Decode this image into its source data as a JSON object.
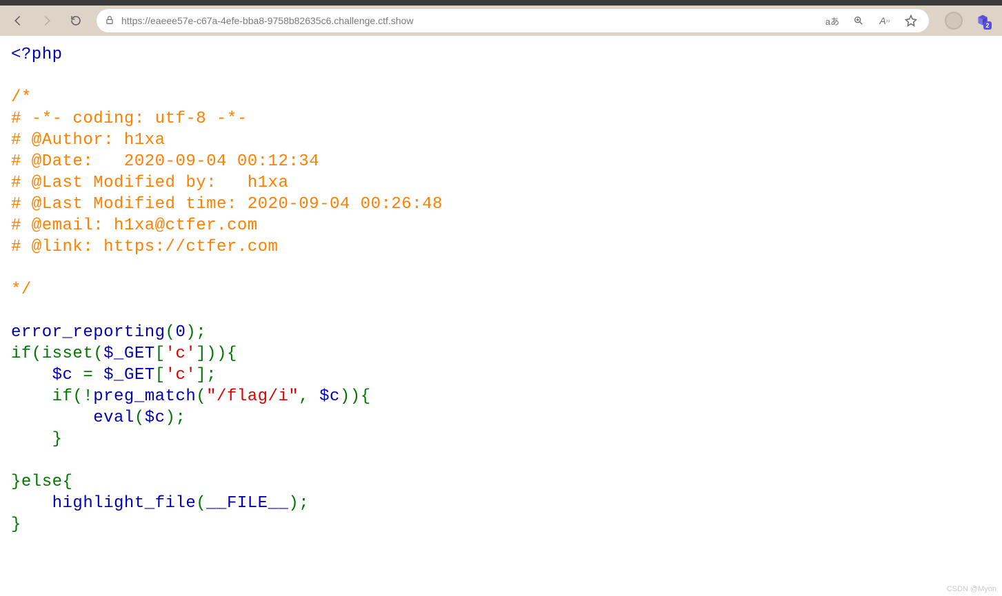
{
  "toolbar": {
    "url": "https://eaeee57e-c67a-4efe-bba8-9758b82635c6.challenge.ctf.show",
    "translate_label": "aあ",
    "ext_badge": "2"
  },
  "code": {
    "php_open": "<?php",
    "comment_open": "/*",
    "c1": "# -*- coding: utf-8 -*-",
    "c2": "# @Author: h1xa",
    "c3": "# @Date:   2020-09-04 00:12:34",
    "c4": "# @Last Modified by:   h1xa",
    "c5": "# @Last Modified time: 2020-09-04 00:26:48",
    "c6": "# @email: h1xa@ctfer.com",
    "c7": "# @link: https://ctfer.com",
    "comment_close": "*/",
    "fn_error_reporting": "error_reporting",
    "paren_open": "(",
    "zero": "0",
    "paren_close_semi": ");",
    "nl": "\n",
    "kw_if": "if(",
    "kw_isset": "isset(",
    "var_get": "$_GET",
    "br_open": "[",
    "str_c": "'c'",
    "br_close": "]",
    "close_isset_if_open": ")){",
    "indent1": "    ",
    "var_c": "$c ",
    "eq": "= ",
    "semi": ";",
    "kw_if2": "if(!",
    "fn_pregmatch": "preg_match",
    "str_flag": "\"/flag/i\"",
    "comma": ", ",
    "close_if_open2": ")){",
    "fn_eval": "eval",
    "brace_close": "}",
    "kw_else": "}else{",
    "fn_highlight": "highlight_file",
    "const_file": "__FILE__",
    "brace_close2": "}"
  },
  "watermark": "CSDN @Myon⁣"
}
